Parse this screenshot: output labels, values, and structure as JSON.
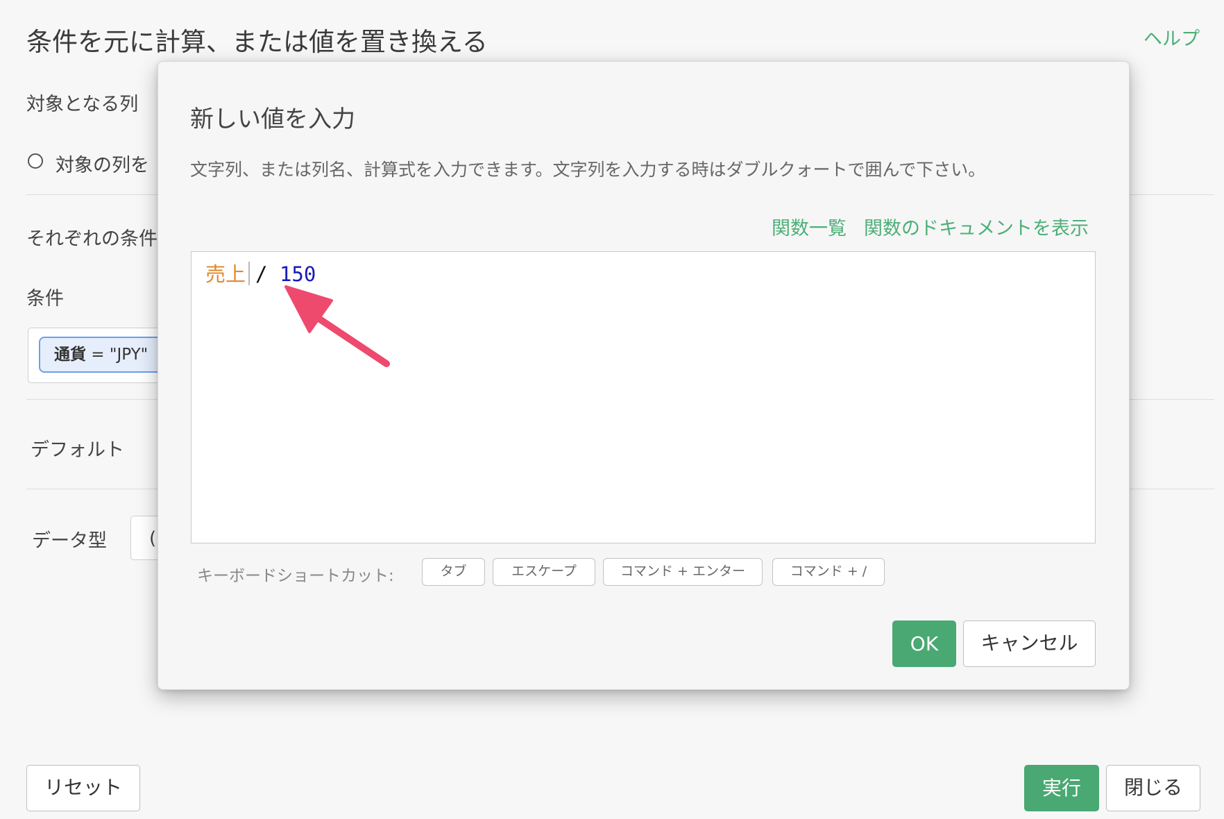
{
  "background": {
    "title": "条件を元に計算、または値を置き換える",
    "help_link": "ヘルプ",
    "target_column_label": "対象となる列",
    "target_radio_label": "対象の列を",
    "each_condition_label": "それぞれの条件",
    "condition_label": "条件",
    "condition_pill": {
      "column": "通貨",
      "rest": " = \"JPY\""
    },
    "default_label": "デフォルト",
    "data_type_label": "データ型",
    "data_type_value": "(",
    "reset_button": "リセット",
    "run_button": "実行",
    "close_button": "閉じる"
  },
  "modal": {
    "title": "新しい値を入力",
    "description": "文字列、または列名、計算式を入力できます。文字列を入力する時はダブルクォートで囲んで下さい。",
    "function_list_link": "関数一覧",
    "function_docs_link": "関数のドキュメントを表示",
    "editor": {
      "column_token": "売上",
      "operator_token": "/",
      "number_token": "150"
    },
    "shortcuts_label": "キーボードショートカット:",
    "shortcut_keys": [
      "タブ",
      "エスケープ",
      "コマンド + エンター",
      "コマンド + /"
    ],
    "ok_button": "OK",
    "cancel_button": "キャンセル"
  },
  "colors": {
    "accent_green": "#4aa872",
    "link_green": "#4caf78",
    "arrow_pink": "#ee4a6e",
    "column_token": "#e08a2e",
    "number_token": "#1a1ab8"
  }
}
